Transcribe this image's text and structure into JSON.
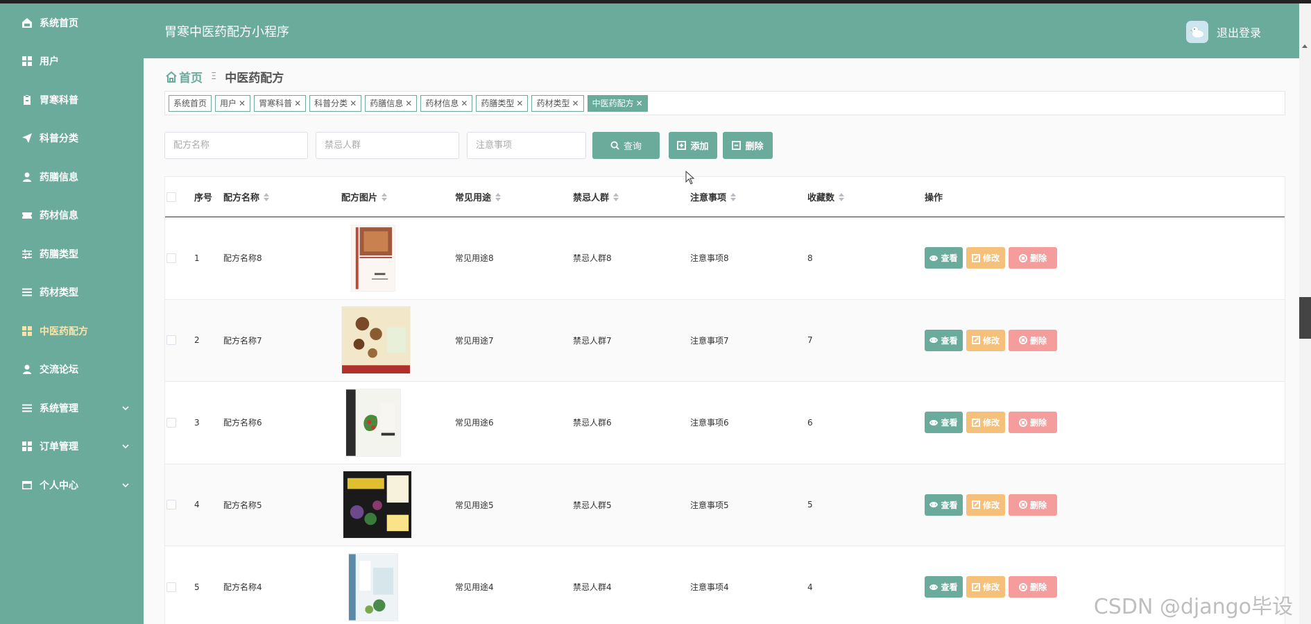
{
  "app": {
    "title": "胃寒中医药配方小程序",
    "logout_label": "退出登录"
  },
  "sidebar": {
    "items": [
      {
        "label": "系统首页",
        "icon": "home-icon"
      },
      {
        "label": "用户",
        "icon": "grid-icon"
      },
      {
        "label": "胃寒科普",
        "icon": "clipboard-icon"
      },
      {
        "label": "科普分类",
        "icon": "send-icon"
      },
      {
        "label": "药膳信息",
        "icon": "user-icon"
      },
      {
        "label": "药材信息",
        "icon": "ticket-icon"
      },
      {
        "label": "药膳类型",
        "icon": "sliders-icon"
      },
      {
        "label": "药材类型",
        "icon": "list-icon"
      },
      {
        "label": "中医药配方",
        "icon": "grid-icon",
        "active": true
      },
      {
        "label": "交流论坛",
        "icon": "user-icon"
      },
      {
        "label": "系统管理",
        "icon": "list-icon",
        "has_children": true
      },
      {
        "label": "订单管理",
        "icon": "grid-icon",
        "has_children": true
      },
      {
        "label": "个人中心",
        "icon": "card-icon",
        "has_children": true
      }
    ]
  },
  "breadcrumb": {
    "home": "首页",
    "separator": "Ξ",
    "current": "中医药配方"
  },
  "tags": [
    {
      "label": "系统首页",
      "closable": false
    },
    {
      "label": "用户",
      "closable": true
    },
    {
      "label": "胃寒科普",
      "closable": true
    },
    {
      "label": "科普分类",
      "closable": true
    },
    {
      "label": "药膳信息",
      "closable": true
    },
    {
      "label": "药材信息",
      "closable": true
    },
    {
      "label": "药膳类型",
      "closable": true
    },
    {
      "label": "药材类型",
      "closable": true
    },
    {
      "label": "中医药配方",
      "closable": true,
      "active": true
    }
  ],
  "search": {
    "name_placeholder": "配方名称",
    "forbidden_placeholder": "禁忌人群",
    "notice_placeholder": "注意事项",
    "query_label": "查询",
    "add_label": "添加",
    "delete_label": "删除"
  },
  "table": {
    "headers": {
      "index": "序号",
      "name": "配方名称",
      "image": "配方图片",
      "usage": "常见用途",
      "forbidden": "禁忌人群",
      "notice": "注意事项",
      "favorites": "收藏数",
      "actions": "操作"
    },
    "rows": [
      {
        "index": "1",
        "name": "配方名称8",
        "usage": "常见用途8",
        "forbidden": "禁忌人群8",
        "notice": "注意事项8",
        "favorites": "8",
        "cover": "book-cover-1"
      },
      {
        "index": "2",
        "name": "配方名称7",
        "usage": "常见用途7",
        "forbidden": "禁忌人群7",
        "notice": "注意事项7",
        "favorites": "7",
        "cover": "book-cover-2"
      },
      {
        "index": "3",
        "name": "配方名称6",
        "usage": "常见用途6",
        "forbidden": "禁忌人群6",
        "notice": "注意事项6",
        "favorites": "6",
        "cover": "book-cover-3"
      },
      {
        "index": "4",
        "name": "配方名称5",
        "usage": "常见用途5",
        "forbidden": "禁忌人群5",
        "notice": "注意事项5",
        "favorites": "5",
        "cover": "book-cover-4"
      },
      {
        "index": "5",
        "name": "配方名称4",
        "usage": "常见用途4",
        "forbidden": "禁忌人群4",
        "notice": "注意事项4",
        "favorites": "4",
        "cover": "book-cover-5"
      }
    ],
    "row_actions": {
      "view": "查看",
      "edit": "修改",
      "delete": "删除"
    }
  },
  "watermark": "CSDN @django毕设",
  "colors": {
    "primary": "#6aab9c",
    "active_menu": "#f9e3a6",
    "edit": "#f5c07a",
    "delete": "#f59d9d"
  }
}
